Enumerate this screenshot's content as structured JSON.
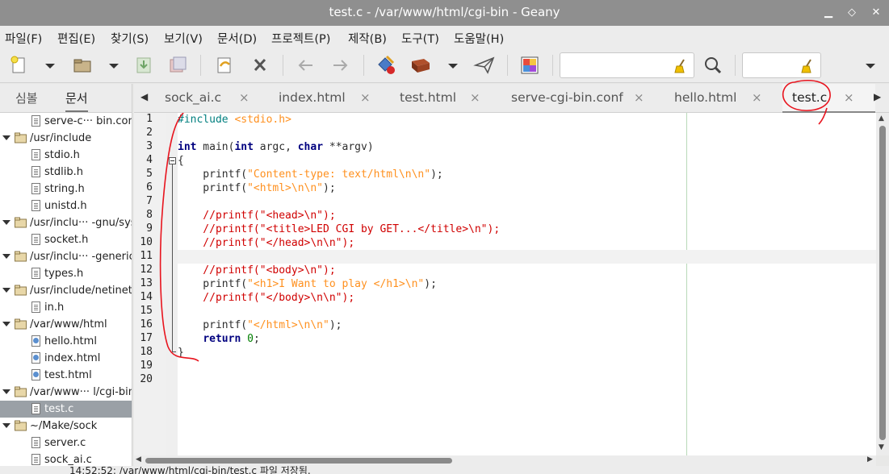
{
  "window": {
    "title": "test.c - /var/www/html/cgi-bin - Geany"
  },
  "menu": [
    "파일(F)",
    "편집(E)",
    "찾기(S)",
    "보기(V)",
    "문서(D)",
    "프로젝트(P)",
    "제작(B)",
    "도구(T)",
    "도움말(H)"
  ],
  "toolbar": {
    "search_value": "",
    "goto_value": ""
  },
  "sidebar": {
    "tabs": [
      "심볼",
      "문서"
    ],
    "active_tab": "문서",
    "tree": [
      {
        "type": "file",
        "label": "serve-c··· bin.conf"
      },
      {
        "type": "folder",
        "label": "/usr/include"
      },
      {
        "type": "file",
        "label": "stdio.h"
      },
      {
        "type": "file",
        "label": "stdlib.h"
      },
      {
        "type": "file",
        "label": "string.h"
      },
      {
        "type": "file",
        "label": "unistd.h"
      },
      {
        "type": "folder",
        "label": "/usr/inclu··· -gnu/sys"
      },
      {
        "type": "file",
        "label": "socket.h"
      },
      {
        "type": "folder",
        "label": "/usr/inclu··· -generic"
      },
      {
        "type": "file",
        "label": "types.h"
      },
      {
        "type": "folder",
        "label": "/usr/include/netinet"
      },
      {
        "type": "file",
        "label": "in.h"
      },
      {
        "type": "folder",
        "label": "/var/www/html"
      },
      {
        "type": "html",
        "label": "hello.html"
      },
      {
        "type": "html",
        "label": "index.html"
      },
      {
        "type": "html",
        "label": "test.html"
      },
      {
        "type": "folder",
        "label": "/var/www··· l/cgi-bin"
      },
      {
        "type": "file",
        "label": "test.c",
        "selected": true
      },
      {
        "type": "folder",
        "label": "~/Make/sock"
      },
      {
        "type": "file",
        "label": "server.c"
      },
      {
        "type": "file",
        "label": "sock_ai.c"
      }
    ]
  },
  "tabs": [
    {
      "label": "sock_ai.c",
      "close": "×"
    },
    {
      "label": "index.html",
      "close": "×"
    },
    {
      "label": "test.html",
      "close": "×"
    },
    {
      "label": "serve-cgi-bin.conf",
      "close": "×"
    },
    {
      "label": "hello.html",
      "close": "×"
    },
    {
      "label": "test.c",
      "close": "×",
      "active": true
    }
  ],
  "editor": {
    "line_numbers": [
      "1",
      "2",
      "3",
      "4",
      "5",
      "6",
      "7",
      "8",
      "9",
      "10",
      "11",
      "12",
      "13",
      "14",
      "15",
      "16",
      "17",
      "18",
      "19",
      "20"
    ],
    "current_line": 11,
    "lines": [
      "#include <stdio.h>",
      "",
      "int main(int argc, char **argv)",
      "{",
      "    printf(\"Content-type: text/html\\n\\n\");",
      "    printf(\"<html>\\n\\n\");",
      "",
      "    //printf(\"<head>\\n\");",
      "    //printf(\"<title>LED CGI by GET...</title>\\n\");",
      "    //printf(\"</head>\\n\\n\");",
      "",
      "    //printf(\"<body>\\n\");",
      "    printf(\"<h1>I Want to play </h1>\\n\");",
      "    //printf(\"</body>\\n\\n\");",
      "",
      "    printf(\"</html>\\n\\n\");",
      "    return 0;",
      "}",
      "",
      ""
    ]
  },
  "status": {
    "text": "14:52:52: /var/www/html/cgi-bin/test.c 파일 저장됨."
  },
  "colors": {
    "annotation": "#e8141e",
    "selection": "#9aa0a6",
    "titlebar": "#8f8f8f"
  }
}
